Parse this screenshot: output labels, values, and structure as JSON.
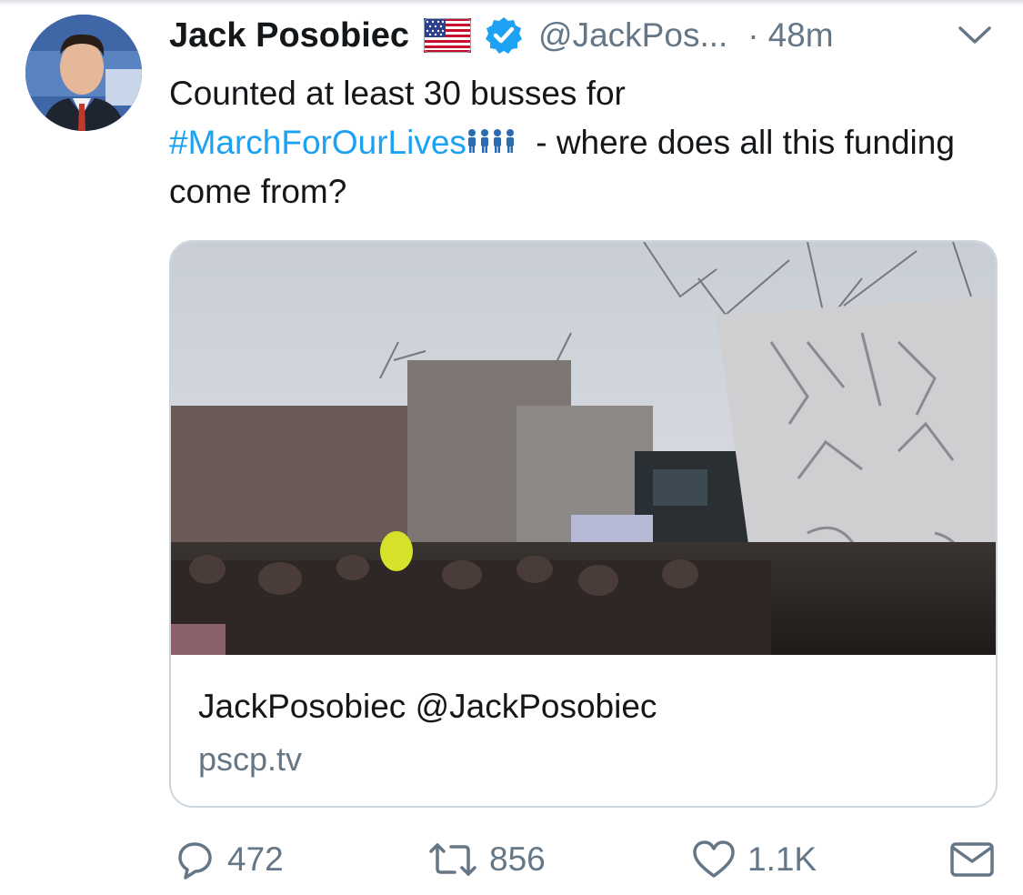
{
  "tweet": {
    "author": {
      "display_name": "Jack Posobiec",
      "handle": "@JackPos...",
      "flag_icon": "us-flag-icon",
      "verified_icon": "verified-badge-icon"
    },
    "separator": "·",
    "time": "48m",
    "text": {
      "line1": "Counted at least 30 busses for",
      "hashtag": "#MarchForOurLives",
      "emoji": "people-group-emoji",
      "rest": " - where does all this funding come from?"
    },
    "card": {
      "title": "JackPosobiec @JackPosobiec",
      "domain": "pscp.tv"
    },
    "actions": {
      "replies": "472",
      "retweets": "856",
      "likes": "1.1K"
    }
  },
  "colors": {
    "link": "#1da1f2",
    "secondary_text": "#657786",
    "primary_text": "#14171a",
    "border": "#ccd6dd"
  }
}
